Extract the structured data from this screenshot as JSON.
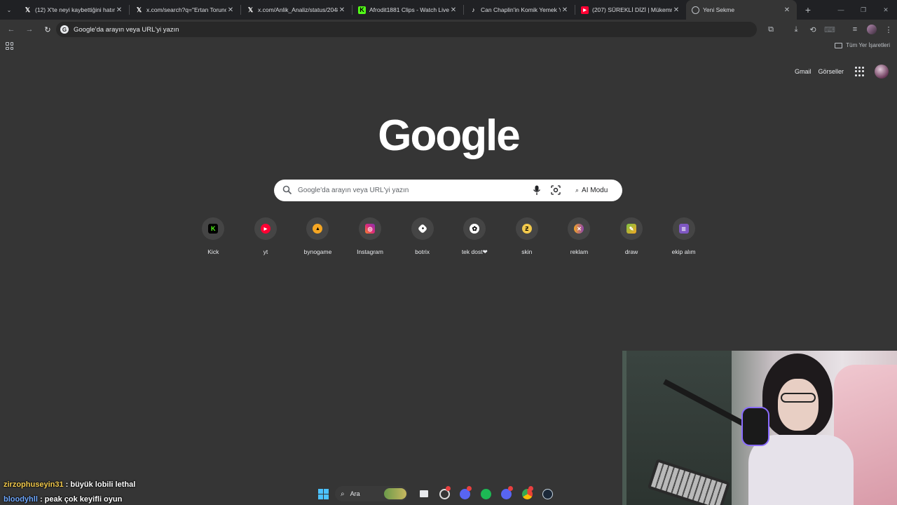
{
  "tabs": [
    {
      "title": "(12) X'te neyi kaybettiğini hatırl",
      "favicon": "x-icon"
    },
    {
      "title": "x.com/search?q=\"Ertan Torunog",
      "favicon": "x-icon"
    },
    {
      "title": "x.com/Anlik_Analiz/status/2048",
      "favicon": "x-icon"
    },
    {
      "title": "Afrodit1881 Clips - Watch Live",
      "favicon": "kick-icon"
    },
    {
      "title": "Can Chaplin'in Komik Yemek Yi",
      "favicon": "tiktok-icon"
    },
    {
      "title": "(207) SÜREKLİ DİZİ | Mükemme",
      "favicon": "youtube-icon"
    },
    {
      "title": "Yeni Sekme",
      "favicon": "chrome-icon"
    }
  ],
  "omnibox": {
    "text": "Google'da arayın veya URL'yi yazın"
  },
  "bookmarks": {
    "all_label": "Tüm Yer İşaretleri"
  },
  "google": {
    "gmail": "Gmail",
    "images": "Görseller",
    "logo": "Google",
    "search_placeholder": "Google'da arayın veya URL'yi yazın",
    "ai_mode": "AI Modu"
  },
  "shortcuts": [
    {
      "label": "Kick",
      "icon": "kick-icon",
      "color": "#53fc18"
    },
    {
      "label": "yt",
      "icon": "youtube-icon",
      "color": "#ff0033"
    },
    {
      "label": "bynogame",
      "icon": "bynogame-icon",
      "color": "#f5a623"
    },
    {
      "label": "Instagram",
      "icon": "instagram-icon",
      "color": "#d6249f"
    },
    {
      "label": "botrix",
      "icon": "botrix-icon",
      "color": "#ffffff"
    },
    {
      "label": "tek dost❤",
      "icon": "chatgpt-icon",
      "color": "#ffffff"
    },
    {
      "label": "skin",
      "icon": "skin-icon",
      "color": "#f2c94c"
    },
    {
      "label": "reklam",
      "icon": "reklam-icon",
      "color": "#f5a623"
    },
    {
      "label": "draw",
      "icon": "draw-icon",
      "color": "#7cc242"
    },
    {
      "label": "ekip alım",
      "icon": "form-icon",
      "color": "#7e57c2"
    }
  ],
  "chat": [
    {
      "user": "zirzophuseyin31",
      "message": "büyük lobili lethal"
    },
    {
      "user": "bloodyhll",
      "message": "peak çok keyifli oyun"
    }
  ],
  "taskbar": {
    "search_label": "Ara"
  }
}
